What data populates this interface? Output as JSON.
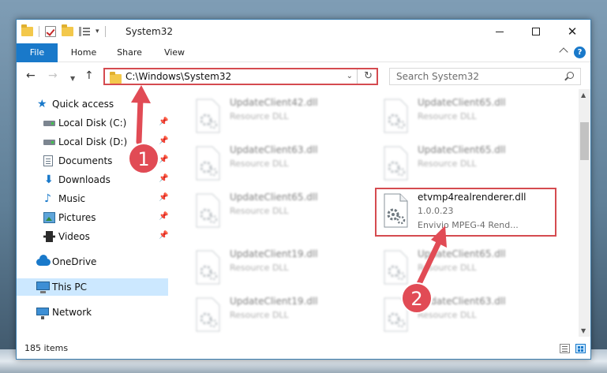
{
  "window": {
    "title": "System32",
    "controls": {
      "minimize_icon": "minimize-icon",
      "maximize_icon": "maximize-icon",
      "close_icon": "close-icon"
    }
  },
  "ribbon": {
    "tabs": [
      {
        "label": "File",
        "active": true
      },
      {
        "label": "Home",
        "active": false
      },
      {
        "label": "Share",
        "active": false
      },
      {
        "label": "View",
        "active": false
      }
    ],
    "help_label": "?"
  },
  "address": {
    "path": "C:\\Windows\\System32",
    "search_placeholder": "Search System32"
  },
  "sidebar": {
    "items": [
      {
        "label": "Quick access",
        "icon": "star-icon",
        "pinned": false
      },
      {
        "label": "Local Disk (C:)",
        "icon": "disk-icon",
        "pinned": true
      },
      {
        "label": "Local Disk (D:)",
        "icon": "disk-icon",
        "pinned": true
      },
      {
        "label": "Documents",
        "icon": "documents-icon",
        "pinned": true
      },
      {
        "label": "Downloads",
        "icon": "downloads-icon",
        "pinned": true
      },
      {
        "label": "Music",
        "icon": "music-icon",
        "pinned": true
      },
      {
        "label": "Pictures",
        "icon": "pictures-icon",
        "pinned": true
      },
      {
        "label": "Videos",
        "icon": "videos-icon",
        "pinned": true
      },
      {
        "label": "OneDrive",
        "icon": "onedrive-icon",
        "pinned": false
      },
      {
        "label": "This PC",
        "icon": "pc-icon",
        "pinned": false,
        "selected": true
      },
      {
        "label": "Network",
        "icon": "network-icon",
        "pinned": false
      }
    ]
  },
  "files": [
    {
      "name": "UpdateClient42.dll",
      "type": "Resource DLL",
      "blurred": true
    },
    {
      "name": "UpdateClient65.dll",
      "type": "Resource DLL",
      "blurred": true
    },
    {
      "name": "UpdateClient63.dll",
      "type": "Resource DLL",
      "blurred": true
    },
    {
      "name": "UpdateClient65.dll",
      "type": "Resource DLL",
      "blurred": true
    },
    {
      "name": "UpdateClient65.dll",
      "type": "Resource DLL",
      "blurred": true
    },
    {
      "name": "etvmp4realrenderer.dll",
      "version": "1.0.0.23",
      "type": "Envivio MPEG-4 Rend...",
      "blurred": false,
      "highlighted": true
    },
    {
      "name": "UpdateClient19.dll",
      "type": "Resource DLL",
      "blurred": true
    },
    {
      "name": "UpdateClient65.dll",
      "type": "Resource DLL",
      "blurred": true
    },
    {
      "name": "UpdateClient19.dll",
      "type": "Resource DLL",
      "blurred": true
    },
    {
      "name": "UpdateClient63.dll",
      "type": "Resource DLL",
      "blurred": true
    }
  ],
  "status": {
    "item_count": "185 items"
  },
  "annotations": {
    "step1_label": "1",
    "step2_label": "2",
    "color": "#d54b50"
  },
  "colors": {
    "accent": "#1979ca",
    "highlight": "#d54b50",
    "selection": "#cce8ff"
  }
}
